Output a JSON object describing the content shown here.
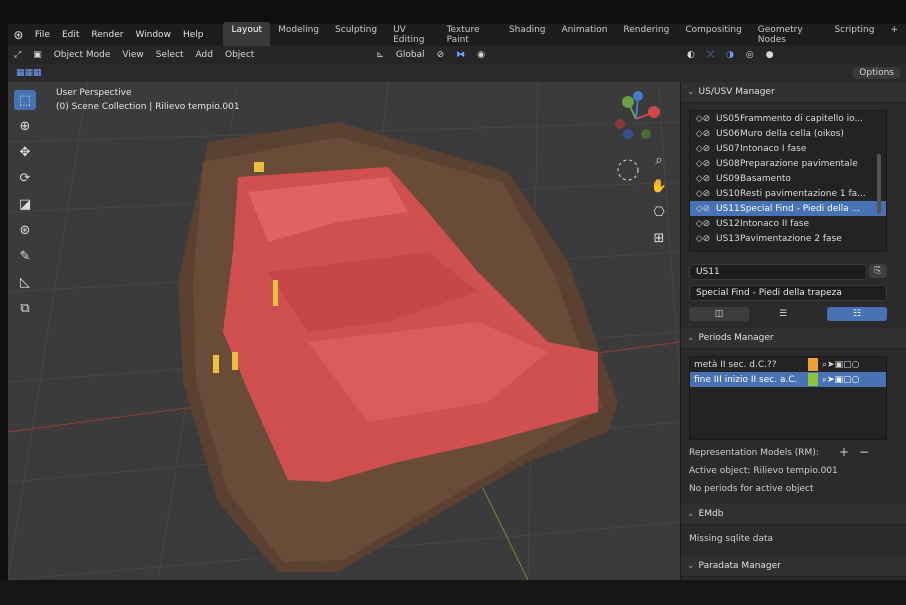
{
  "app": {
    "logo_icon": "blender-logo-icon"
  },
  "menu": [
    "File",
    "Edit",
    "Render",
    "Window",
    "Help"
  ],
  "workspaces": {
    "tabs": [
      "Layout",
      "Modeling",
      "Sculpting",
      "UV Editing",
      "Texture Paint",
      "Shading",
      "Animation",
      "Rendering",
      "Compositing",
      "Geometry Nodes",
      "Scripting"
    ],
    "active": "Layout",
    "add_label": "+"
  },
  "header": {
    "mode": "Object Mode",
    "menus": [
      "View",
      "Select",
      "Add",
      "Object"
    ],
    "orientation": "Global",
    "options_label": "Options"
  },
  "viewport": {
    "view_name": "User Perspective",
    "collection": "(0) Scene Collection | Rilievo tempio.001",
    "tools": [
      "select-box-icon",
      "cursor-icon",
      "move-icon",
      "rotate-icon",
      "scale-icon",
      "transform-icon",
      "annotate-icon",
      "measure-icon",
      "add-cube-icon"
    ]
  },
  "us_manager": {
    "title": "US/USV Manager",
    "items": [
      {
        "code": "US05",
        "name": "Frammento di capitello io..."
      },
      {
        "code": "US06",
        "name": "Muro della cella (oikos)"
      },
      {
        "code": "US07",
        "name": "Intonaco I fase"
      },
      {
        "code": "US08",
        "name": "Preparazione pavimentale"
      },
      {
        "code": "US09",
        "name": "Basamento"
      },
      {
        "code": "US10",
        "name": "Resti pavimentazione 1 fa..."
      },
      {
        "code": "US11",
        "name": "Special Find - Piedi della ..."
      },
      {
        "code": "US12",
        "name": "Intonaco II fase"
      },
      {
        "code": "US13",
        "name": "Pavimentazione 2 fase"
      }
    ],
    "selected_index": 6,
    "name_value": "US11",
    "description_value": "Special Find - Piedi della trapeza"
  },
  "periods_manager": {
    "title": "Periods Manager",
    "items": [
      {
        "name": "metà II sec. d.C.??",
        "color": "#f0a030"
      },
      {
        "name": "fine III inizio II sec. a.C.",
        "color": "#8cc43c"
      }
    ],
    "selected_index": 1,
    "rm_label": "Representation Models (RM):",
    "active_object": "Active object: Rilievo tempio.001",
    "no_periods": "No periods for active object"
  },
  "emdb": {
    "title": "EMdb",
    "status": "Missing sqlite data"
  },
  "paradata": {
    "title": "Paradata Manager"
  },
  "colors": {
    "accent": "#4772b3",
    "model_red": "#d05050"
  }
}
